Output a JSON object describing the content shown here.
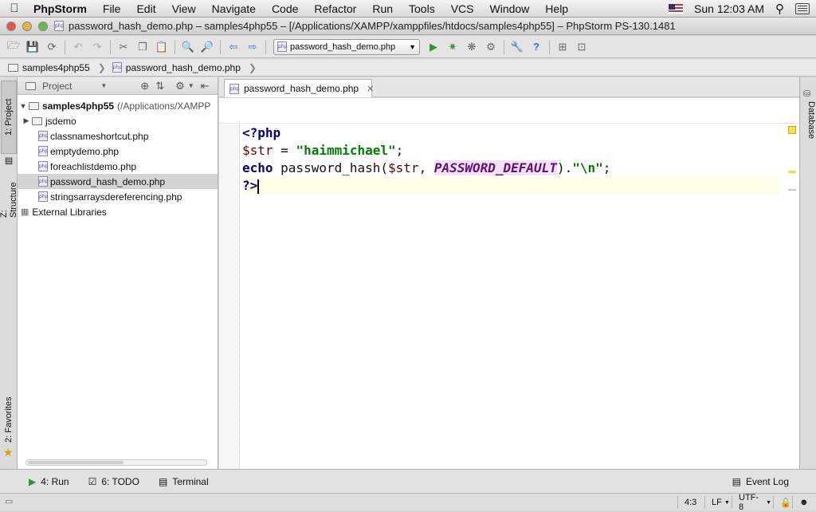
{
  "menubar": {
    "app_name": "PhpStorm",
    "items": [
      "File",
      "Edit",
      "View",
      "Navigate",
      "Code",
      "Refactor",
      "Run",
      "Tools",
      "VCS",
      "Window",
      "Help"
    ],
    "clock": "Sun 12:03 AM"
  },
  "window": {
    "title": "password_hash_demo.php – samples4php55 – [/Applications/XAMPP/xamppfiles/htdocs/samples4php55] – PhpStorm PS-130.1481"
  },
  "toolbar": {
    "run_config": "password_hash_demo.php"
  },
  "navbar": {
    "crumbs": [
      "samples4php55",
      "password_hash_demo.php"
    ]
  },
  "leftstrip": {
    "project_tab": "1: Project",
    "structure_tab": "Z: Structure",
    "favorites_tab": "2: Favorites"
  },
  "project": {
    "header": "Project",
    "root_name": "samples4php55",
    "root_path": "(/Applications/XAMPP",
    "items": [
      {
        "label": "jsdemo",
        "type": "folder"
      },
      {
        "label": "classnameshortcut.php",
        "type": "file"
      },
      {
        "label": "emptydemo.php",
        "type": "file"
      },
      {
        "label": "foreachlistdemo.php",
        "type": "file"
      },
      {
        "label": "password_hash_demo.php",
        "type": "file",
        "selected": true
      },
      {
        "label": "stringsarraysdereferencing.php",
        "type": "file"
      }
    ],
    "external": "External Libraries"
  },
  "editor": {
    "tab_label": "password_hash_demo.php",
    "code": {
      "line1": "<?php",
      "l2_var": "$str",
      "l2_eq": " = ",
      "l2_str": "\"haimmichael\"",
      "l2_end": ";",
      "l3_kw": "echo",
      "l3_fn": " password_hash(",
      "l3_var": "$str",
      "l3_comma": ", ",
      "l3_const": "PASSWORD_DEFAULT",
      "l3_close": ").",
      "l3_str": "\"\\n\"",
      "l3_end": ";",
      "line4": "?>"
    }
  },
  "rightstrip": {
    "database_tab": "Database"
  },
  "bottombar": {
    "run": "4: Run",
    "todo": "6: TODO",
    "terminal": "Terminal",
    "event_log": "Event Log"
  },
  "statusbar": {
    "position": "4:3",
    "line_sep": "LF",
    "encoding": "UTF-8"
  },
  "colors": {
    "keyword": "#000080",
    "string": "#008000",
    "constant": "#660e7a",
    "variable": "#660000",
    "selection": "#d4d4d4"
  }
}
